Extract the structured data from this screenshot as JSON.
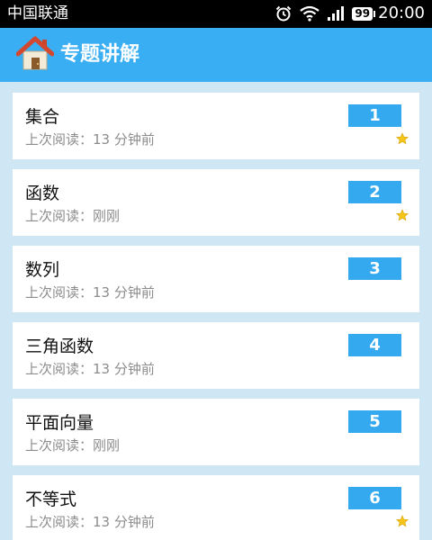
{
  "status_bar": {
    "carrier": "中国联通",
    "battery": "99",
    "time": "20:00"
  },
  "app_bar": {
    "title": "专题讲解",
    "icon": "home-icon"
  },
  "topics": [
    {
      "title": "集合",
      "badge": "1",
      "status": "上次阅读：13 分钟前",
      "starred": true
    },
    {
      "title": "函数",
      "badge": "2",
      "status": "上次阅读：刚刚",
      "starred": true
    },
    {
      "title": "数列",
      "badge": "3",
      "status": "上次阅读：13 分钟前",
      "starred": false
    },
    {
      "title": "三角函数",
      "badge": "4",
      "status": "上次阅读：13 分钟前",
      "starred": false
    },
    {
      "title": "平面向量",
      "badge": "5",
      "status": "上次阅读：刚刚",
      "starred": false
    },
    {
      "title": "不等式",
      "badge": "6",
      "status": "上次阅读：13 分钟前",
      "starred": true
    }
  ],
  "colors": {
    "app_bar": "#3aaef2",
    "badge": "#35a9ef",
    "list_background": "#cfe6f5",
    "star": "#f5c518"
  }
}
